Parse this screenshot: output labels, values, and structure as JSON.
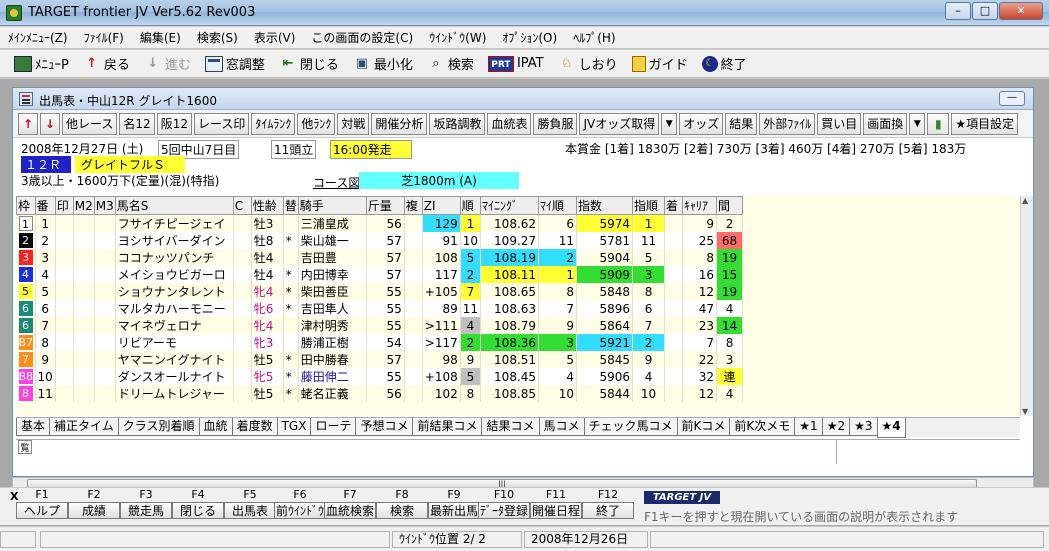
{
  "window": {
    "title": "TARGET frontier JV  Ver5.62  Rev003",
    "min": "–",
    "max": "□",
    "close": "✕"
  },
  "menu": [
    "ﾒｲﾝﾒﾆｭｰ(Z)",
    "ﾌｧｲﾙ(F)",
    "編集(E)",
    "検索(S)",
    "表示(V)",
    "この画面の設定(C)",
    "ｳｲﾝﾄﾞｳ(W)",
    "ｵﾌﾟｼｮﾝ(O)",
    "ﾍﾙﾌﾟ(H)"
  ],
  "toolbar": {
    "menu": "ﾒﾆｭｰP",
    "back": "戻る",
    "forward": "進む",
    "window_adjust": "窓調整",
    "close": "閉じる",
    "minimize": "最小化",
    "search": "検索",
    "prt": "PRT",
    "ipat": "IPAT",
    "bookmark": "しおり",
    "guide": "ガイド",
    "exit": "終了"
  },
  "child": {
    "title": "出馬表・中山12R グレイト1600",
    "buttons": [
      "他レース",
      "名12",
      "阪12",
      "レース印",
      "ﾀｲﾑﾗﾝｸ",
      "他ﾗﾝｸ",
      "対戦",
      "開催分析",
      "坂路調教",
      "血統表",
      "勝負服",
      "JVオッズ取得",
      "オッズ",
      "結果",
      "外部ﾌｧｲﾙ",
      "買い目",
      "画面換",
      "★項目設定"
    ],
    "up": "↑",
    "down": "↓",
    "dropdown": "▼",
    "min": "—"
  },
  "race": {
    "date": "2008年12月27日 (土)",
    "meeting": "5回中山7日目",
    "runners": "11頭立",
    "start": "16:00発走",
    "prize": "本賞金 [1着] 1830万 [2着] 730万 [3着] 460万 [4着] 270万 [5着] 183万",
    "race_no": "１２Ｒ",
    "race_name": "グレイトフルＳ",
    "conditions": "3歳以上・1600万下(定量)(混)(特指)",
    "course_label": "コース図",
    "course": "芝1800m (A)"
  },
  "table": {
    "headers": [
      "枠",
      "番",
      "印",
      "M2",
      "M3",
      "馬名S",
      "C",
      "性齢",
      "替",
      "騎手",
      "斤量",
      "複",
      "ZI",
      "順",
      "ﾏｲﾆﾝｸﾞ",
      "ﾏｲ順",
      "指数",
      "指順",
      "着",
      "ｷｬﾘｱ",
      "間"
    ],
    "rows": [
      {
        "waku": "1",
        "num": "1",
        "name": "フサイチピージェイ",
        "sex": "牡3",
        "change": "",
        "jockey": "三浦皇成",
        "weight": "56",
        "zi": "129",
        "zi_rank": "1",
        "mining": "108.62",
        "mining_rank": "6",
        "index": "5974",
        "index_rank": "1",
        "chaku": "",
        "career": "9",
        "interval": "2"
      },
      {
        "waku": "2",
        "num": "2",
        "name": "ヨシサイバーダイン",
        "sex": "牡8",
        "change": "*",
        "jockey": "柴山雄一",
        "weight": "57",
        "zi": "91",
        "zi_rank": "10",
        "mining": "109.27",
        "mining_rank": "11",
        "index": "5781",
        "index_rank": "11",
        "chaku": "",
        "career": "25",
        "interval": "68"
      },
      {
        "waku": "3",
        "num": "3",
        "name": "ココナッツパンチ",
        "sex": "牡4",
        "change": "",
        "jockey": "吉田豊",
        "weight": "57",
        "zi": "108",
        "zi_rank": "5",
        "mining": "108.19",
        "mining_rank": "2",
        "index": "5904",
        "index_rank": "5",
        "chaku": "",
        "career": "8",
        "interval": "19"
      },
      {
        "waku": "4",
        "num": "4",
        "name": "メイショウビガーロ",
        "sex": "牡4",
        "change": "*",
        "jockey": "内田博幸",
        "weight": "57",
        "zi": "117",
        "zi_rank": "2",
        "mining": "108.11",
        "mining_rank": "1",
        "index": "5909",
        "index_rank": "3",
        "chaku": "",
        "career": "16",
        "interval": "15"
      },
      {
        "waku": "5",
        "num": "5",
        "name": "ショウナンタレント",
        "sex": "牝4",
        "change": "*",
        "jockey": "柴田善臣",
        "weight": "55",
        "zi": "+105",
        "zi_rank": "7",
        "mining": "108.65",
        "mining_rank": "8",
        "index": "5848",
        "index_rank": "8",
        "chaku": "",
        "career": "12",
        "interval": "19"
      },
      {
        "waku": "6",
        "num": "6",
        "name": "マルタカハーモニー",
        "sex": "牝6",
        "change": "*",
        "jockey": "吉田隼人",
        "weight": "55",
        "zi": "89",
        "zi_rank": "11",
        "mining": "108.63",
        "mining_rank": "7",
        "index": "5896",
        "index_rank": "6",
        "chaku": "",
        "career": "47",
        "interval": "4"
      },
      {
        "waku": "6",
        "num": "7",
        "name": "マイネヴェロナ",
        "sex": "牝4",
        "change": "",
        "jockey": "津村明秀",
        "weight": "55",
        "zi": ">111",
        "zi_rank": "4",
        "mining": "108.79",
        "mining_rank": "9",
        "index": "5864",
        "index_rank": "7",
        "chaku": "",
        "career": "23",
        "interval": "14"
      },
      {
        "waku": "B7",
        "num": "8",
        "name": "リビアーモ",
        "sex": "牝3",
        "change": "",
        "jockey": "勝浦正樹",
        "weight": "54",
        "zi": ">117",
        "zi_rank": "2",
        "mining": "108.36",
        "mining_rank": "3",
        "index": "5921",
        "index_rank": "2",
        "chaku": "",
        "career": "7",
        "interval": "8"
      },
      {
        "waku": "7",
        "num": "9",
        "name": "ヤマニンイグナイト",
        "sex": "牡5",
        "change": "*",
        "jockey": "田中勝春",
        "weight": "57",
        "zi": "98",
        "zi_rank": "9",
        "mining": "108.51",
        "mining_rank": "5",
        "index": "5845",
        "index_rank": "9",
        "chaku": "",
        "career": "22",
        "interval": "3"
      },
      {
        "waku": "B8",
        "num": "10",
        "name": "ダンスオールナイト",
        "sex": "牝5",
        "change": "*",
        "jockey": "藤田伸二",
        "weight": "55",
        "zi": "+108",
        "zi_rank": "5",
        "mining": "108.45",
        "mining_rank": "4",
        "index": "5906",
        "index_rank": "4",
        "chaku": "",
        "career": "32",
        "interval": "連"
      },
      {
        "waku": "8",
        "num": "11",
        "name": "ドリームトレジャー",
        "sex": "牡5",
        "change": "*",
        "jockey": "蛯名正義",
        "weight": "56",
        "zi": "102",
        "zi_rank": "8",
        "mining": "108.85",
        "mining_rank": "10",
        "index": "5844",
        "index_rank": "10",
        "chaku": "",
        "career": "12",
        "interval": "4"
      }
    ]
  },
  "waku_colors": {
    "1": [
      "#ffffff",
      "#000000"
    ],
    "2": [
      "#000000",
      "#ffffff"
    ],
    "3": [
      "#ff2020",
      "#ffffff"
    ],
    "4": [
      "#1e2fe0",
      "#ffffff"
    ],
    "5": [
      "#ffff33",
      "#000000"
    ],
    "6": [
      "#1a8a7a",
      "#ffffff"
    ],
    "B7": [
      "#ff8c1a",
      "#ffffff"
    ],
    "7": [
      "#ff8c1a",
      "#ffffff"
    ],
    "B8": [
      "#ff40e0",
      "#ffffff"
    ],
    "8": [
      "#ff40e0",
      "#ffffff"
    ]
  },
  "highlight_colors": {
    "cyan": "#33ddff",
    "yellow": "#ffff33",
    "green": "#33dd33",
    "gray": "#c0c0c0",
    "red": "#ff6a6a"
  },
  "tabs": [
    "基本",
    "補正タイム",
    "クラス別着順",
    "血統",
    "着度数",
    "TGX",
    "ローテ",
    "予想コメ",
    "前結果コメ",
    "結果コメ",
    "馬コメ",
    "チェック馬コメ",
    "前Kコメ",
    "前K次メモ",
    "★1",
    "★2",
    "★3",
    "★4"
  ],
  "memo_mark": "覧",
  "fkeys": [
    {
      "k": "F1",
      "l": "ヘルプ"
    },
    {
      "k": "F2",
      "l": "成績"
    },
    {
      "k": "F3",
      "l": "競走馬"
    },
    {
      "k": "F4",
      "l": "閉じる"
    },
    {
      "k": "F5",
      "l": "出馬表"
    },
    {
      "k": "F6",
      "l": "前ｳｲﾝﾄﾞｳ"
    },
    {
      "k": "F7",
      "l": "血統検索"
    },
    {
      "k": "F8",
      "l": "検索"
    },
    {
      "k": "F9",
      "l": "最新出馬"
    },
    {
      "k": "F10",
      "l": "ﾃﾞｰﾀ登録"
    },
    {
      "k": "F11",
      "l": "開催日程"
    },
    {
      "k": "F12",
      "l": "終了"
    }
  ],
  "fkey_x": "X",
  "brand": "TARGET JV",
  "hint": "F1キーを押すと現在開いている画面の説明が表示されます",
  "status": {
    "window_pos": "ｳｲﾝﾄﾞｳ位置 2/ 2",
    "date": "2008年12月26日"
  }
}
